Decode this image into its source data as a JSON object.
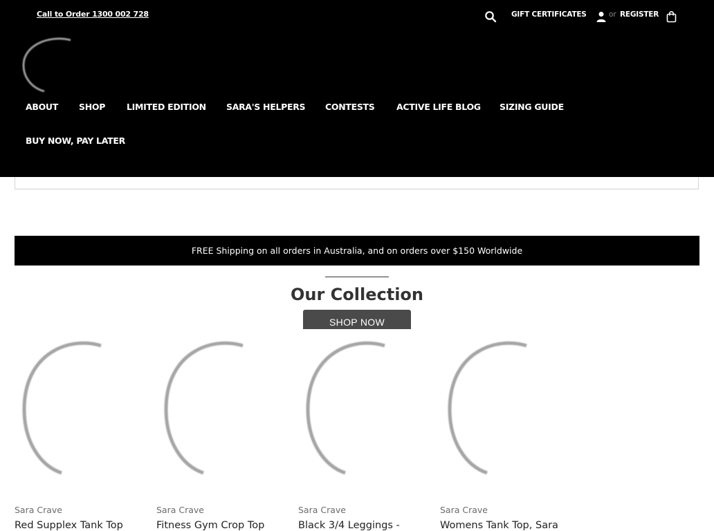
{
  "topbar": {
    "phone_link": "Call to Order 1300 002 728",
    "gift_certificates": "GIFT CERTIFICATES",
    "or_text": "or",
    "register": "REGISTER"
  },
  "icons": {
    "search": "search-icon",
    "user": "user-icon",
    "bag": "shopping-bag-icon",
    "logo": "loading-spinner-icon"
  },
  "nav": {
    "items": [
      "ABOUT",
      "SHOP",
      "LIMITED EDITION",
      "SARA'S HELPERS",
      "CONTESTS",
      "ACTIVE LIFE BLOG",
      "SIZING GUIDE",
      "BUY NOW, PAY LATER"
    ]
  },
  "banner": {
    "shipping": "FREE Shipping on all orders in Australia, and on orders over $150 Worldwide"
  },
  "collection": {
    "title": "Our Collection",
    "cta": "SHOP NOW"
  },
  "products": [
    {
      "brand": "Sara Crave",
      "name": "Red Supplex Tank Top"
    },
    {
      "brand": "Sara Crave",
      "name": "Fitness Gym Crop Top"
    },
    {
      "brand": "Sara Crave",
      "name": "Black 3/4 Leggings -"
    },
    {
      "brand": "Sara Crave",
      "name": "Womens Tank Top, Sara"
    }
  ],
  "colors": {
    "header_bg": "#000000",
    "text_light": "#ffffff",
    "button_bg": "#4a4a4a",
    "heading": "#333333"
  }
}
